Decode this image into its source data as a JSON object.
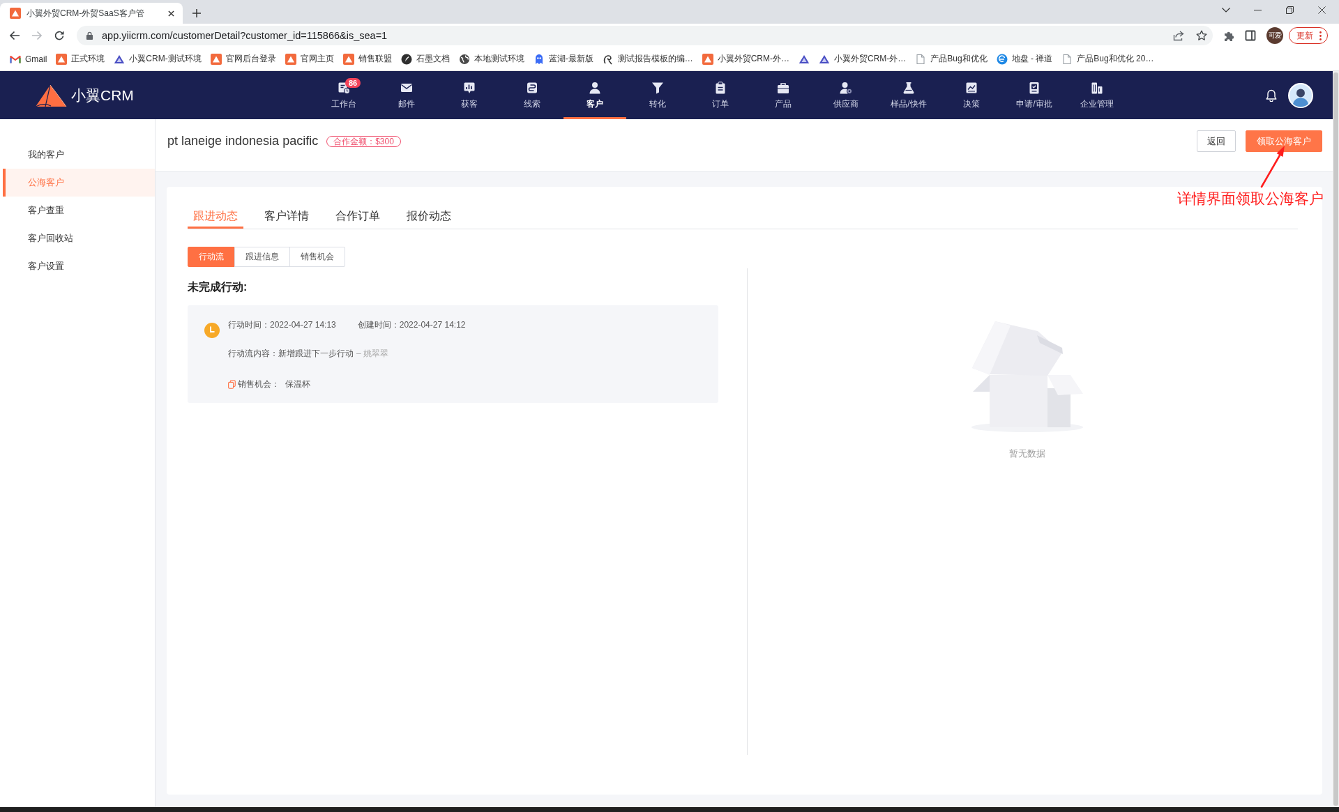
{
  "browser": {
    "tab_title": "小翼外贸CRM-外贸SaaS客户管",
    "url": "app.yiicrm.com/customerDetail?customer_id=115866&is_sea=1",
    "profile": "可爱",
    "update_button": "更新",
    "bookmarks": [
      {
        "kind": "gmail",
        "label": "Gmail"
      },
      {
        "kind": "brand",
        "label": "正式环境"
      },
      {
        "kind": "triangle",
        "label": "小翼CRM-测试环境"
      },
      {
        "kind": "brand",
        "label": "官网后台登录"
      },
      {
        "kind": "brand",
        "label": "官网主页"
      },
      {
        "kind": "brand",
        "label": "销售联盟"
      },
      {
        "kind": "pen",
        "label": "石墨文档"
      },
      {
        "kind": "globe",
        "label": "本地测试环境"
      },
      {
        "kind": "figure",
        "label": "蓝湖-最新版"
      },
      {
        "kind": "swirl",
        "label": "测试报告模板的编…"
      },
      {
        "kind": "brand",
        "label": "小翼外贸CRM-外…"
      },
      {
        "kind": "triangle"
      },
      {
        "kind": "triangle",
        "label": "小翼外贸CRM-外…"
      },
      {
        "kind": "page",
        "label": "产品Bug和优化"
      },
      {
        "kind": "zentao",
        "label": "地盘 - 禅道"
      },
      {
        "kind": "page",
        "label": "产品Bug和优化 20…"
      }
    ]
  },
  "app": {
    "logo": "小翼CRM",
    "nav": [
      {
        "kind": "workbench",
        "label": "工作台",
        "badge": "86",
        "selected": false
      },
      {
        "kind": "mail",
        "label": "邮件",
        "selected": false
      },
      {
        "kind": "acquire",
        "label": "获客",
        "selected": false
      },
      {
        "kind": "leads",
        "label": "线索",
        "selected": false
      },
      {
        "kind": "customer",
        "label": "客户",
        "selected": true
      },
      {
        "kind": "convert",
        "label": "转化",
        "selected": false
      },
      {
        "kind": "order",
        "label": "订单",
        "selected": false
      },
      {
        "kind": "product",
        "label": "产品",
        "selected": false
      },
      {
        "kind": "supplier",
        "label": "供应商",
        "selected": false
      },
      {
        "kind": "sample",
        "label": "样品/快件",
        "selected": false
      },
      {
        "kind": "decision",
        "label": "决策",
        "selected": false
      },
      {
        "kind": "approval",
        "label": "申请/审批",
        "selected": false
      },
      {
        "kind": "enterprise",
        "label": "企业管理",
        "selected": false
      }
    ],
    "sidebar": {
      "items": [
        {
          "label": "我的客户",
          "selected": false
        },
        {
          "label": "公海客户",
          "selected": true
        },
        {
          "label": "客户查重",
          "selected": false
        },
        {
          "label": "客户回收站",
          "selected": false
        },
        {
          "label": "客户设置",
          "selected": false
        }
      ]
    },
    "customer": {
      "name": "pt laneige indonesia pacific",
      "amount_badge": "合作金额：$300"
    },
    "header_buttons": [
      {
        "kind": "default",
        "label": "返回"
      },
      {
        "kind": "primary",
        "label": "领取公海客户"
      }
    ],
    "tabs": [
      {
        "label": "跟进动态",
        "selected": true
      },
      {
        "label": "客户详情",
        "selected": false
      },
      {
        "label": "合作订单",
        "selected": false
      },
      {
        "label": "报价动态",
        "selected": false
      }
    ],
    "subtabs": [
      {
        "label": "行动流",
        "selected": true
      },
      {
        "label": "跟进信息",
        "selected": false
      },
      {
        "label": "销售机会",
        "selected": false
      }
    ],
    "section_title": "未完成行动:",
    "actions": [
      {
        "action_time": "行动时间：2022-04-27 14:13",
        "created_time": "创建时间：2022-04-27 14:12",
        "content": "行动流内容：新增跟进下一步行动",
        "author": "– 姚翠翠",
        "opportunity_label": "销售机会：",
        "opportunity": "保温杯"
      }
    ],
    "empty_state": {
      "text": "暂无数据"
    }
  },
  "annotation": {
    "text": "详情界面领取公海客户"
  }
}
